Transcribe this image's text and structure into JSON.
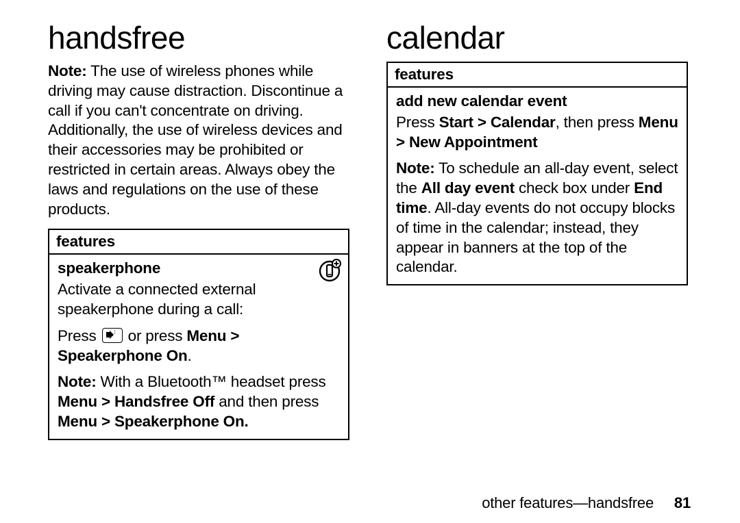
{
  "left": {
    "heading": "handsfree",
    "note_para": "Note: The use of wireless phones while driving may cause distraction. Discontinue a call if you can't concentrate on driving. Additionally, the use of wireless devices and their accessories may be prohibited or restricted in certain areas. Always obey the laws and regulations on the use of these products.",
    "note_label": "Note:",
    "features_label": "features",
    "speakerphone": {
      "title": "speakerphone",
      "desc": "Activate a connected external speakerphone during a call:",
      "press_prefix": "Press ",
      "press_mid": " or press ",
      "menu_path": "Menu > Speakerphone On",
      "press_suffix": ".",
      "bt_note_label": "Note:",
      "bt_note_1": " With a Bluetooth™ headset press ",
      "bt_menu_1": "Menu > Handsfree Off",
      "bt_note_2": " and then press ",
      "bt_menu_2": "Menu > Speakerphone On.",
      "icon_name": "phone-plus-icon"
    }
  },
  "right": {
    "heading": "calendar",
    "features_label": "features",
    "add_event": {
      "title": "add new calendar event",
      "press_prefix": "Press ",
      "start_calendar": "Start > Calendar",
      "press_mid": ", then press ",
      "menu_new": "Menu > New Appointment",
      "note_label": "Note:",
      "note_1": " To schedule an all-day event, select the ",
      "all_day": "All day event",
      "note_2": " check box under ",
      "end_time": "End time",
      "note_3": ". All-day events do not occupy blocks of time in the calendar; instead, they appear in banners at the top of the calendar."
    }
  },
  "footer": {
    "text": "other features—handsfree",
    "page": "81"
  }
}
